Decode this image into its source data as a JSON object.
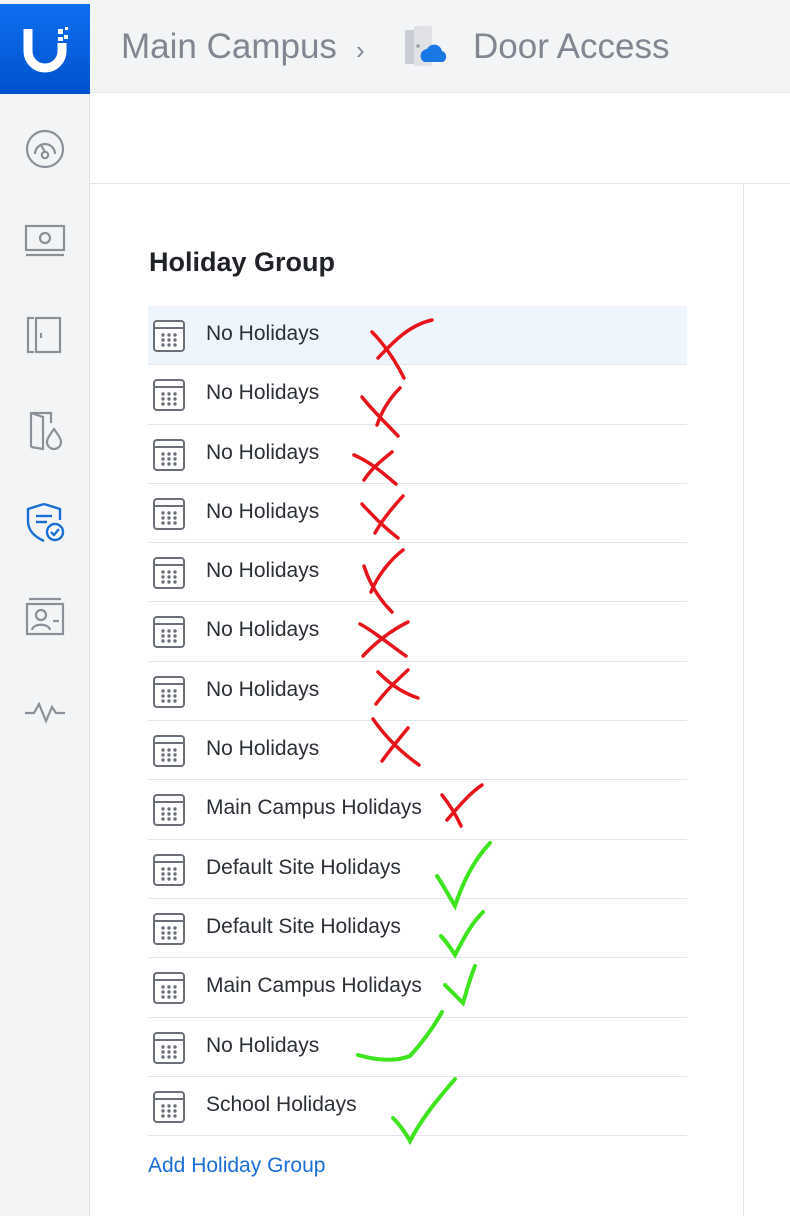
{
  "header": {
    "breadcrumb_site": "Main Campus",
    "breadcrumb_separator": "›",
    "breadcrumb_app": "Door Access",
    "logo_icon": "ubiquiti-logo-icon",
    "app_icon": "door-access-icon"
  },
  "sidebar": {
    "items": [
      {
        "icon": "dashboard-icon"
      },
      {
        "icon": "devices-icon"
      },
      {
        "icon": "doors-icon"
      },
      {
        "icon": "access-policies-icon"
      },
      {
        "icon": "security-shield-icon"
      },
      {
        "icon": "users-icon"
      },
      {
        "icon": "activity-icon"
      }
    ]
  },
  "main": {
    "section_title": "Holiday Group",
    "rows": [
      {
        "label": "No Holidays",
        "annotation": "cross"
      },
      {
        "label": "No Holidays",
        "annotation": "cross"
      },
      {
        "label": "No Holidays",
        "annotation": "cross"
      },
      {
        "label": "No Holidays",
        "annotation": "cross"
      },
      {
        "label": "No Holidays",
        "annotation": "cross"
      },
      {
        "label": "No Holidays",
        "annotation": "cross"
      },
      {
        "label": "No Holidays",
        "annotation": "cross"
      },
      {
        "label": "No Holidays",
        "annotation": "cross"
      },
      {
        "label": "Main Campus Holidays",
        "annotation": "cross"
      },
      {
        "label": "Default Site Holidays",
        "annotation": "check"
      },
      {
        "label": "Default Site Holidays",
        "annotation": "check"
      },
      {
        "label": "Main Campus Holidays",
        "annotation": "check"
      },
      {
        "label": "No Holidays",
        "annotation": "check"
      },
      {
        "label": "School Holidays",
        "annotation": "check"
      }
    ],
    "add_link": "Add Holiday Group"
  },
  "colors": {
    "brand_blue": "#0a63e0",
    "link_blue": "#1a6fd6",
    "selected_row": "#eef5fc",
    "annotation_red": "#e8141b",
    "annotation_green": "#3ee51e"
  }
}
